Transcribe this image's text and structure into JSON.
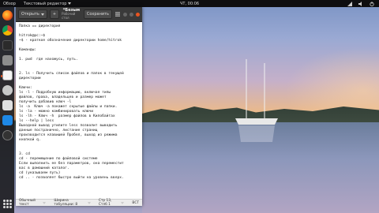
{
  "topbar": {
    "activities": "Обзор",
    "app_name": "Текстовый редактор",
    "clock": "ЧТ, 00:06",
    "colors": {
      "accent": "#e95420"
    }
  },
  "dock": {
    "icons": [
      "firefox-icon",
      "chrome-icon",
      "terminal-icon",
      "files-icon",
      "text-editor-icon",
      "settings-icon",
      "app-icon",
      "app-icon-2",
      "app-icon-3",
      "show-apps-icon"
    ]
  },
  "window": {
    "open_label": "Открыть",
    "new_tab_label": "+",
    "title": "*Безым",
    "subtitle": "Рабочий стол",
    "save_label": "Сохранить",
    "text_lines": [
      "Папка == директория",
      "",
      "hitrok@pc:~$",
      "~$ - краткое обозначение директории home/hitrok",
      "",
      "Команды:",
      "",
      "1. pwd  где нахожусь, путь.",
      "",
      "",
      "2. ls - Получить список файлов и папок в текущей",
      "директории",
      "",
      "Ключи:",
      "ls -l - Подробную информацию, включая типы",
      "файлов, права, владельцев и размер может",
      "получить добавив ключ -l",
      "ls -a  Ключ -a покажет скрытые файлы и папки.",
      "ls -la - можно комбинировать ключи",
      "ls -lh - Ключ -h  размер файлов в Килобайтах",
      "ls --help | less",
      "Выходной вывод утилите less позволит выводить",
      "данные постранично, листание страниц",
      "производится клавишей Пробел, выход из режима",
      "кнопкой q.",
      "",
      "",
      "3. cd",
      "cd - перемещение по файловой системе",
      "Если выполнить ее без параметров, она переместит",
      "вас в домашний каталог.",
      "cd (указываем путь)",
      "cd .. - позволяет быстро выйти на уровень вверх."
    ],
    "status": {
      "syntax": "Обычный текст",
      "tab_width": "Ширина табуляции: 8",
      "position": "Стр 13, Стлб 1",
      "mode": "ВСТ"
    }
  }
}
